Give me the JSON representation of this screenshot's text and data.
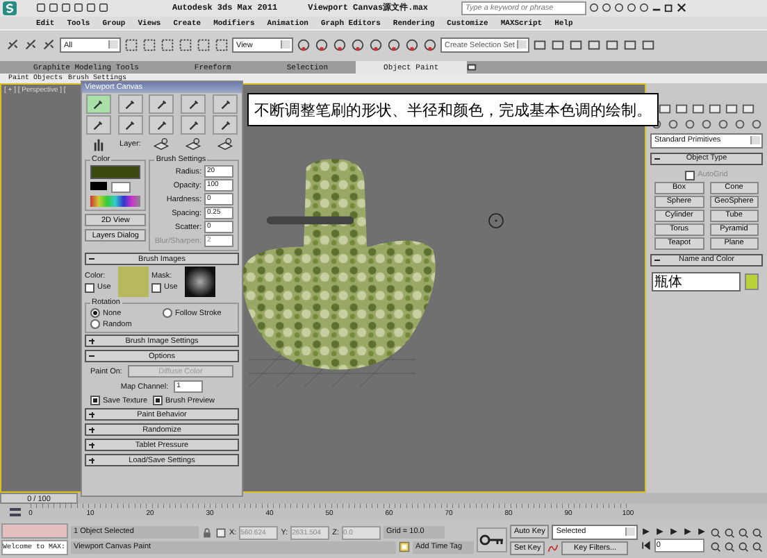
{
  "window": {
    "title": "Autodesk 3ds Max  2011",
    "file": "Viewport Canvas源文件.max",
    "search": {
      "placeholder": "Type a keyword or phrase"
    }
  },
  "menu": [
    "Edit",
    "Tools",
    "Group",
    "Views",
    "Create",
    "Modifiers",
    "Animation",
    "Graph Editors",
    "Rendering",
    "Customize",
    "MAXScript",
    "Help"
  ],
  "toolbar": {
    "selection_filter": "All",
    "reference_coord": "View",
    "selection_set": {
      "placeholder": "Create Selection Set"
    }
  },
  "ribbon": {
    "tabs": [
      {
        "label": "Graphite Modeling Tools",
        "selected": false
      },
      {
        "label": "Freeform",
        "selected": false
      },
      {
        "label": "Selection",
        "selected": false
      },
      {
        "label": "Object Paint",
        "selected": true
      }
    ],
    "panels": [
      "Paint Objects",
      "Brush Settings"
    ]
  },
  "viewport": {
    "label": "[ + ] [ Perspective ] [",
    "caption": "不断调整笔刷的形状、半径和颜色，完成基本色调的绘制。"
  },
  "canvas_panel": {
    "title": "Viewport Canvas",
    "tools": [
      {
        "selected": true
      },
      {
        "selected": false
      },
      {
        "selected": false
      },
      {
        "selected": false
      },
      {
        "selected": false
      },
      {
        "selected": false
      },
      {
        "selected": false
      },
      {
        "selected": false
      },
      {
        "selected": false
      },
      {
        "selected": false
      }
    ],
    "layer_label": "Layer:",
    "color_group": "Color",
    "brush_settings": {
      "title": "Brush Settings",
      "rows": [
        {
          "label": "Radius:",
          "value": "20",
          "disabled": false
        },
        {
          "label": "Opacity:",
          "value": "100",
          "disabled": false
        },
        {
          "label": "Hardness:",
          "value": "0",
          "disabled": false
        },
        {
          "label": "Spacing:",
          "value": "0.25",
          "disabled": false
        },
        {
          "label": "Scatter:",
          "value": "0",
          "disabled": false
        },
        {
          "label": "Blur/Sharpen:",
          "value": "2",
          "disabled": true
        }
      ]
    },
    "view_2d": "2D View",
    "layers_dialog": "Layers Dialog",
    "brush_images": {
      "title": "Brush Images",
      "expanded": true,
      "color_label": "Color:",
      "mask_label": "Mask:",
      "color_use": {
        "label": "Use",
        "checked": false
      },
      "mask_use": {
        "label": "Use",
        "checked": false
      },
      "rotation": {
        "title": "Rotation",
        "options": [
          {
            "label": "None",
            "selected": true
          },
          {
            "label": "Follow Stroke",
            "selected": false
          },
          {
            "label": "Random",
            "selected": false
          }
        ]
      }
    },
    "brush_image_settings": {
      "title": "Brush Image Settings",
      "expanded": false
    },
    "options": {
      "title": "Options",
      "expanded": true,
      "paint_on_label": "Paint On:",
      "paint_on": {
        "label": "Diffuse Color",
        "disabled": true
      },
      "map_channel_label": "Map Channel:",
      "map_channel": "1",
      "checks": [
        {
          "label": "Save Texture",
          "checked": true
        },
        {
          "label": "Brush Preview",
          "checked": true
        }
      ]
    },
    "rollouts": [
      {
        "title": "Paint Behavior",
        "expanded": false
      },
      {
        "title": "Randomize",
        "expanded": false
      },
      {
        "title": "Tablet Pressure",
        "expanded": false
      },
      {
        "title": "Load/Save Settings",
        "expanded": false
      }
    ]
  },
  "command_panel": {
    "category": "Standard Primitives",
    "object_type": {
      "title": "Object Type",
      "expanded": true,
      "autogrid": {
        "label": "AutoGrid",
        "checked": false,
        "disabled": true
      },
      "buttons": [
        "Box",
        "Cone",
        "Sphere",
        "GeoSphere",
        "Cylinder",
        "Tube",
        "Torus",
        "Pyramid",
        "Teapot",
        "Plane"
      ]
    },
    "name_and_color": {
      "title": "Name and Color",
      "expanded": true,
      "name": "瓶体",
      "color": "#b8d23c"
    }
  },
  "timeline": {
    "slider": "0 / 100",
    "level": 0,
    "labels": [
      "0",
      "10",
      "20",
      "30",
      "40",
      "50",
      "60",
      "70",
      "80",
      "90",
      "100"
    ]
  },
  "status_bar": {
    "listener": "Welcome to MAX:",
    "selection": "1 Object Selected",
    "prompt": "Viewport Canvas Paint",
    "coords": [
      {
        "label": "X:",
        "value": "560.624"
      },
      {
        "label": "Y:",
        "value": "2631.504"
      },
      {
        "label": "Z:",
        "value": "0.0"
      }
    ],
    "grid": "Grid = 10.0",
    "add_time_tag": "Add Time Tag",
    "auto_key": "Auto Key",
    "set_key": "Set Key",
    "key_mode": "Selected",
    "key_filters": "Key Filters...",
    "frame": "0"
  }
}
